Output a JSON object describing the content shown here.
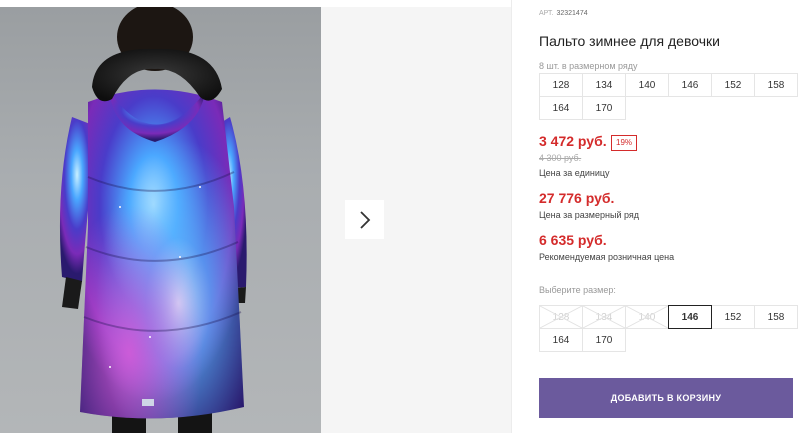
{
  "gallery": {
    "next_arrow_icon": "chevron-right-icon"
  },
  "product": {
    "article_label": "АРТ.",
    "article_number": "32321474",
    "title": "Пальто зимнее для девочки",
    "size_row_label": "8 шт. в размерном ряду",
    "size_row": [
      "128",
      "134",
      "140",
      "146",
      "152",
      "158",
      "164",
      "170"
    ]
  },
  "pricing": {
    "unit_price": "3 472 руб.",
    "discount": "19%",
    "old_price": "4 300 руб.",
    "unit_caption": "Цена за единицу",
    "row_price": "27 776 руб.",
    "row_caption": "Цена за размерный ряд",
    "retail_price": "6 635 руб.",
    "retail_caption": "Рекомендуемая розничная цена",
    "accent_color": "#d42b2b"
  },
  "size_select": {
    "label": "Выберите размер:",
    "options": [
      {
        "value": "128",
        "available": false
      },
      {
        "value": "134",
        "available": false
      },
      {
        "value": "140",
        "available": false
      },
      {
        "value": "146",
        "available": true
      },
      {
        "value": "152",
        "available": true
      },
      {
        "value": "158",
        "available": true
      },
      {
        "value": "164",
        "available": true
      },
      {
        "value": "170",
        "available": true
      }
    ],
    "selected": "146"
  },
  "cart": {
    "add_button_label": "ДОБАВИТЬ В КОРЗИНУ",
    "button_color": "#6b5a9d"
  }
}
